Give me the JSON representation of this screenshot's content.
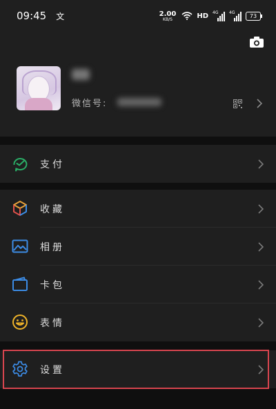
{
  "status_bar": {
    "time": "09:45",
    "lang_icon": "文",
    "speed_value": "2.00",
    "speed_unit": "KB/S",
    "hd": "HD",
    "signal1_label": "4G",
    "signal2_label": "4G",
    "battery": "73"
  },
  "profile": {
    "wxid_label": "微信号:"
  },
  "menu": {
    "pay": "支付",
    "favorites": "收藏",
    "album": "相册",
    "cards": "卡包",
    "stickers": "表情",
    "settings": "设置"
  },
  "colors": {
    "pay_green": "#2aae67",
    "accent_blue": "#3c8ce6",
    "sticker_yellow": "#f0b429",
    "highlight_red": "#d9454f"
  }
}
